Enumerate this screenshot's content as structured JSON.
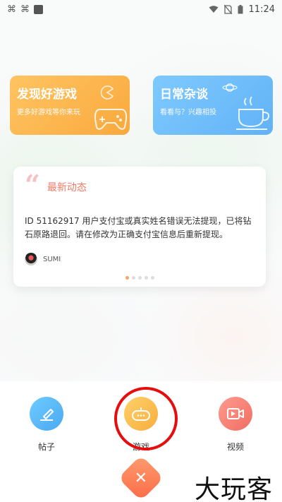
{
  "status_bar": {
    "time": "11:24",
    "left_icons": [
      "notification-icon",
      "notification-icon",
      "app-square-icon"
    ],
    "right_icons": [
      "wifi-icon",
      "no-sim-icon",
      "battery-icon"
    ]
  },
  "categories": [
    {
      "title": "发现好游戏",
      "subtitle": "更多好游戏等你来玩",
      "icon": "gamepad-icon",
      "color": "#f9b04a"
    },
    {
      "title": "日常杂谈",
      "subtitle": "看看与？兴趣相投",
      "icon": "coffee-cup-icon",
      "color": "#6ab8f8"
    }
  ],
  "news": {
    "title": "最新动态",
    "body": "ID 51162917 用户支付宝或真实姓名错误无法提现，已将钻石原路退回。请在修改为正确支付宝信息后重新提现。",
    "author": "SUMI",
    "page_count": 5,
    "active_page": 0
  },
  "actions": [
    {
      "label": "帖子",
      "icon": "edit-post-icon"
    },
    {
      "label": "游戏",
      "icon": "game-controller-icon"
    },
    {
      "label": "视频",
      "icon": "video-camera-icon"
    }
  ],
  "close_icon": "close-icon",
  "watermark": "大玩客",
  "colors": {
    "accent_orange": "#fb6c48",
    "highlight_red": "#e60d0d",
    "news_title": "#f07a66"
  }
}
